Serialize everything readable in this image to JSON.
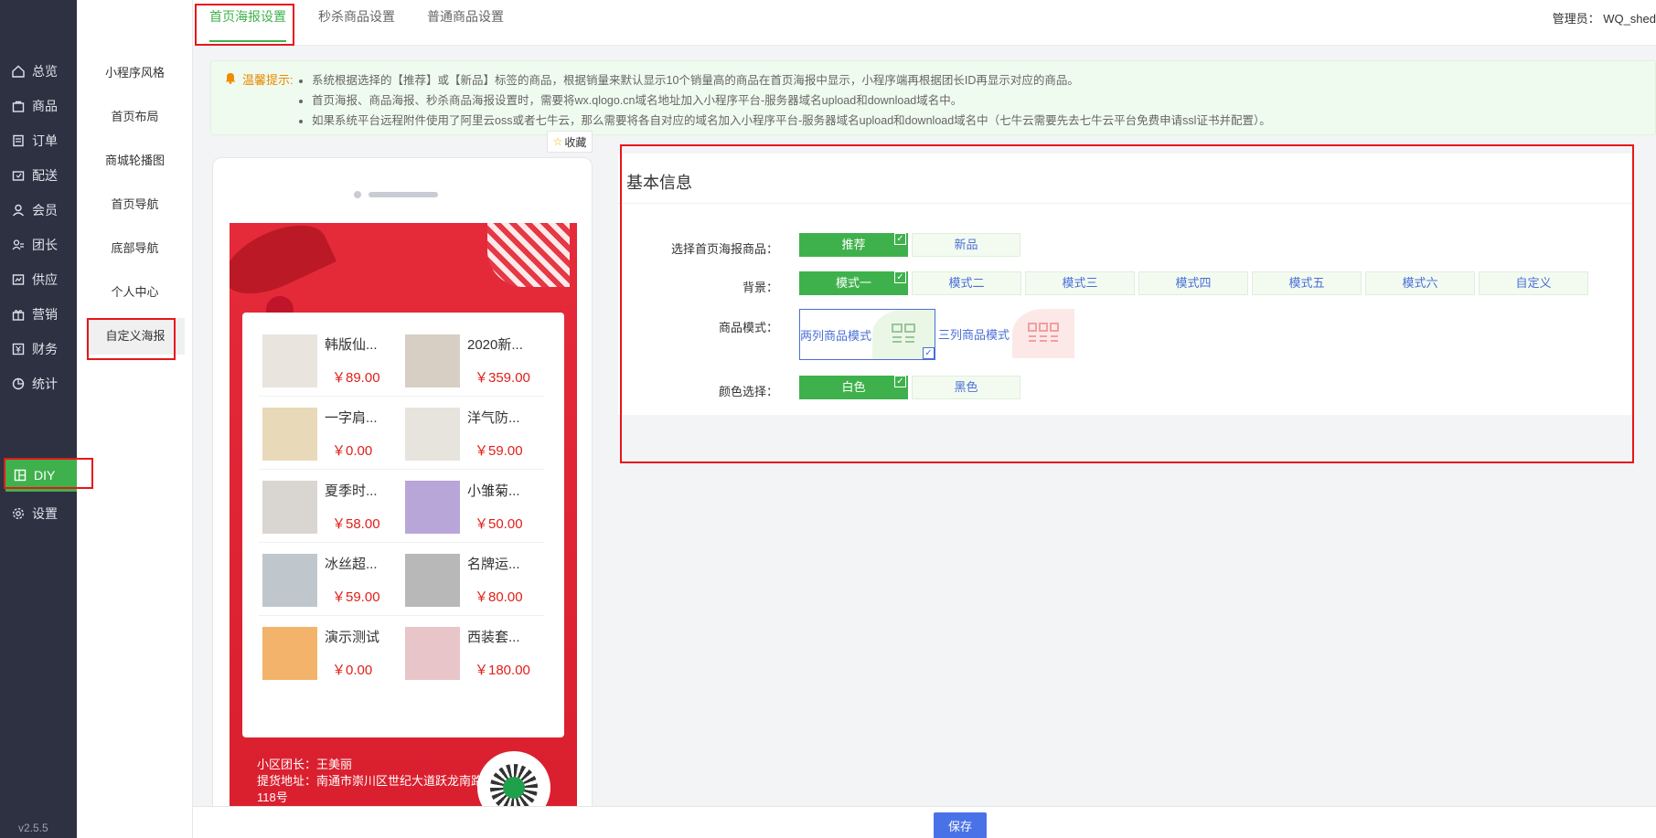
{
  "nav": {
    "items": [
      {
        "label": "总览",
        "icon": "home-icon"
      },
      {
        "label": "商品",
        "icon": "bag-icon"
      },
      {
        "label": "订单",
        "icon": "order-icon"
      },
      {
        "label": "配送",
        "icon": "delivery-icon"
      },
      {
        "label": "会员",
        "icon": "user-icon"
      },
      {
        "label": "团长",
        "icon": "leader-icon"
      },
      {
        "label": "供应",
        "icon": "supply-icon"
      },
      {
        "label": "营销",
        "icon": "gift-icon"
      },
      {
        "label": "财务",
        "icon": "finance-icon"
      },
      {
        "label": "统计",
        "icon": "stats-icon"
      },
      {
        "label": "DIY",
        "icon": "diy-icon"
      },
      {
        "label": "设置",
        "icon": "gear-icon"
      }
    ],
    "active": "DIY",
    "version": "v2.5.5"
  },
  "subnav": {
    "items": [
      "小程序风格",
      "首页布局",
      "商城轮播图",
      "首页导航",
      "底部导航",
      "个人中心",
      "自定义海报"
    ],
    "active": "自定义海报"
  },
  "tabs": [
    "首页海报设置",
    "秒杀商品设置",
    "普通商品设置"
  ],
  "admin": "管理员： WQ_shed",
  "tip": {
    "title": "温馨提示:",
    "lines": [
      "系统根据选择的【推荐】或【新品】标签的商品，根据销量来默认显示10个销量高的商品在首页海报中显示，小程序端再根据团长ID再显示对应的商品。",
      "首页海报、商品海报、秒杀商品海报设置时，需要将wx.qlogo.cn域名地址加入小程序平台-服务器域名upload和download域名中。",
      "如果系统平台远程附件使用了阿里云oss或者七牛云，那么需要将各自对应的域名加入小程序平台-服务器域名upload和download域名中（七牛云需要先去七牛云平台免费申请ssl证书并配置）。"
    ]
  },
  "collect": "收藏",
  "poster": {
    "products": [
      {
        "name": "韩版仙...",
        "price": "￥89.00",
        "color": "#e9e4de"
      },
      {
        "name": "2020新...",
        "price": "￥359.00",
        "color": "#d7cfc4"
      },
      {
        "name": "一字肩...",
        "price": "￥0.00",
        "color": "#e8d9b8"
      },
      {
        "name": "洋气防...",
        "price": "￥59.00",
        "color": "#e7e3dd"
      },
      {
        "name": "夏季时...",
        "price": "￥58.00",
        "color": "#d9d6d2"
      },
      {
        "name": "小雏菊...",
        "price": "￥50.00",
        "color": "#b9a6d8"
      },
      {
        "name": "冰丝超...",
        "price": "￥59.00",
        "color": "#bfc6cc"
      },
      {
        "name": "名牌运...",
        "price": "￥80.00",
        "color": "#b8b8b8"
      },
      {
        "name": "演示测试",
        "price": "￥0.00",
        "color": "#f3b36b"
      },
      {
        "name": "西装套...",
        "price": "￥180.00",
        "color": "#e7c5c9"
      }
    ],
    "leader": "小区团长：王美丽",
    "address": "提货地址：南通市崇川区世纪大道跃龙南路118号"
  },
  "panel": {
    "title": "基本信息",
    "rows": {
      "goods": {
        "label": "选择首页海报商品：",
        "options": [
          "推荐",
          "新品"
        ],
        "selected": 0
      },
      "background": {
        "label": "背景：",
        "options": [
          "模式一",
          "模式二",
          "模式三",
          "模式四",
          "模式五",
          "模式六",
          "自定义"
        ],
        "selected": 0
      },
      "mode": {
        "label": "商品模式：",
        "options": [
          "两列商品模式",
          "三列商品模式"
        ],
        "selected": 0
      },
      "color": {
        "label": "颜色选择：",
        "options": [
          "白色",
          "黑色"
        ],
        "selected": 0
      }
    }
  },
  "save_label": "保存",
  "colors": {
    "accent": "#3fb14c",
    "link": "#4a6fd6",
    "price": "#e0201a",
    "highlight": "#e6161b"
  }
}
